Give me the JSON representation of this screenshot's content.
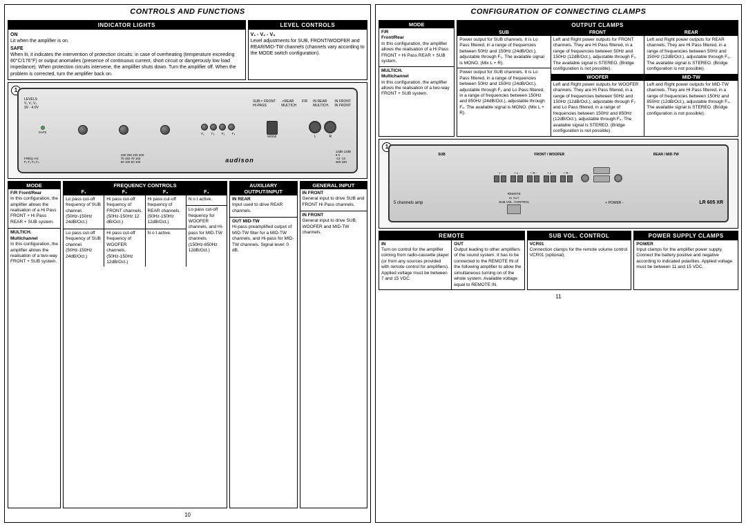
{
  "left": {
    "title": "CONTROLS AND FUNCTIONS",
    "indicator_lights": {
      "header": "INDICATOR LIGHTS",
      "on_label": "ON",
      "on_text": "Lit when the amplifier is on.",
      "safe_label": "SAFE",
      "safe_text": "When lit, it indicates the intervention of protection circuits: in case of overheating (temperature exceeding 80°C/176°F) or output anomalies (presence of continuous current, short circuit or dangerously low load impedance). When protection circuits intervene, the amplifier shuts down. Turn the amplifier off. When the problem is corrected, turn the amplifier back on."
    },
    "level_controls": {
      "header": "LEVEL CONTROLS",
      "formula": "V₁ - V₂ - V₃",
      "text": "Level adjustments for SUB, FRONT/WOOFER and REAR/MID-TW channels (channels vary according to the MODE switch configuration)."
    },
    "amp_diagram": {
      "label": "audison",
      "badge": "1"
    },
    "mode_section": {
      "header": "MODE",
      "fr_label": "F/R",
      "fr_sub": "Front/Rear",
      "fr_text": "In this configuration, the amplifier allows the realisation of a Hi Pass FRONT + Hi Pass REAR + SUB system.",
      "multich_label": "MULTICH.",
      "multich_sub": "Multichannel",
      "multich_text": "In this configuration, the amplifier allows the realisation of a two-way FRONT + SUB system."
    },
    "frequency_controls": {
      "header": "FREQUENCY CONTROLS",
      "columns": [
        {
          "header": "F₁",
          "fr_label": "Lo pass cut-off frequency of SUB channel.",
          "fr_range": "(50Hz-150Hz 24dB/Oct.)",
          "multich_label": "Lo pass cut-off frequency of SUB channel.",
          "multich_range": "(50Hz-150Hz 24dB/Oct.)"
        },
        {
          "header": "F₂",
          "fr_label": "Hi pass cut-off frequency of FRONT channels.",
          "fr_range": "(50Hz-150Hz 12 dB/Oct.)",
          "multich_label": "Hi pass cut-off frequency of WOOFER channels.",
          "multich_range": "(50Hz-150Hz 12dB/Oct.)"
        },
        {
          "header": "F₃",
          "fr_label": "Hi pass cut-off frequency of REAR channels.",
          "fr_range": "(50Hz-150Hz 12dB/Oct.)",
          "multich_label": "N o t active.",
          "multich_range": ""
        },
        {
          "header": "F₄",
          "fr_label": "N o t active.",
          "fr_range": "",
          "multich_label": "Lo pass cut-off frequency for WOOFER channels, and Hi-pass for MID-TW channels.",
          "multich_range": "(150Hz-850Hz 12dB/Oct.)"
        }
      ]
    },
    "auxiliary": {
      "header": "AUXILIARY OUTPUT/INPUT",
      "in_rear_label": "IN REAR",
      "in_rear_text": "Input used to drive REAR channels.",
      "out_midtw_label": "OUT MID-TW",
      "out_midtw_text": "Hi-pass preamplified output of MID-TW filter for a MID-TW channels, and Hi-pass for MID-TW channels. Signal level: 0 dB."
    },
    "general_input": {
      "header": "GENERAL INPUT",
      "in_front_label": "IN FRONT",
      "in_front_text_1": "General input to drive SUB and FRONT Hi Pass channels.",
      "in_front_text_2": "General input to drive SUB, WOOFER and MID-TW channels."
    },
    "page_number": "10"
  },
  "right": {
    "title": "CONFIGURATION OF CONNECTING CLAMPS",
    "mode_section": {
      "header": "MODE",
      "fr_label": "F/R",
      "fr_sub": "Front/Rear",
      "fr_text": "In this configuration, the amplifier allows the realisation of a Hi Pass FRONT + Hi Pass REAR + SUB system.",
      "multich_label": "MULTICH.",
      "multich_sub": "Multichannel",
      "multich_text": "In this configuration, the amplifier allows the realisation of a two-way FRONT + SUB system."
    },
    "output_clamps": {
      "header": "OUTPUT CLAMPS",
      "columns": [
        {
          "header": "SUB",
          "fr_text": "Power output for SUB channels. It is Lo Pass filtered, in a range of frequencies between 50Hz and 150Hz (24dB/Oct.), adjustable through F₂. The available signal is MONO. (Mix L + R).",
          "multich_text": "Power output for SUB channels. It is Lo Pass filtered, in a range of frequencies between 50Hz and 150Hz (24dB/Oct.), adjustable through F₂ and Lo Pass filtered, in a range of frequencies between 150Hz and 850Hz (24dB/Oct.), adjustable through F₄. The available signal is MONO. (Mix L + R)."
        },
        {
          "header": "FRONT",
          "fr_text": "Left and Right power outputs for FRONT channels. They are Hi Pass filtered, in a range of frequencies between 50Hz and 150Hz (12dB/Oct.), adjustable through F₂. The available signal is STEREO. (Bridge configuration is not possible).",
          "woofer_header": "WOOFER",
          "woofer_text": "Left and Right power outputs for WOOFER channels. They are Hi Pass filtered, in a range of frequencies between 50Hz and 150Hz (12dB/Oct.), adjustable through F₂ and Lo Pass filtered, in a range of frequencies between 150Hz and 850Hz (12dB/Oct.), adjustable through F₄. The available signal is STEREO. (Bridge configuration is not possible)."
        },
        {
          "header": "REAR",
          "fr_text": "Left and Right power outputs for REAR channels. They are Hi Pass filtered, in a range of frequencies between 50Hz and 150Hz (12dB/Oct.), adjustable through F₃. The available signal is STEREO. (Bridge configuration is not possible).",
          "midtw_header": "MID-TW",
          "midtw_text": "Left and Right power outputs for MID-TW channels. They are Hi Pass filtered, in a range of frequencies between 150Hz and 850Hz (12dB/Oct.), adjustable through F₄. The available signal is STEREO. (Bridge configuration is not possible)."
        }
      ]
    },
    "amp_diagram": {
      "channels_label": "5 channels amp",
      "remote_label": "REMOTE",
      "sub_vol_label": "SUB VOL. CONTROL",
      "model_label": "LR 605 XR",
      "badge": "1"
    },
    "remote": {
      "header": "REMOTE",
      "in_label": "IN",
      "in_text": "Turn on control for the amplifier coming from radio-cassette player (or from any sources provided with remote control for amplifiers). Applied voltage must be between 7 and 15 VDC.",
      "out_label": "OUT",
      "out_text": "Output leading to other amplifiers of the sound system. It has to be connected to the REMOTE IN of the following amplifier to allow the simultaneous turning on of the whole system. Available voltage equal to REMOTE IN."
    },
    "sub_vol_control": {
      "header": "SUB VOL. CONTROL",
      "vcr01_label": "VCR01",
      "vcr01_text": "Connection clamps for the remote volume control VCR01 (optional)."
    },
    "power_supply": {
      "header": "POWER SUPPLY CLAMPS",
      "power_label": "POWER",
      "power_text": "Input clamps for the amplifier power supply. Connect the battery positive and negative according to indicated polarities. Applied voltage must be between 11 and 15 VDC."
    },
    "page_number": "11"
  }
}
